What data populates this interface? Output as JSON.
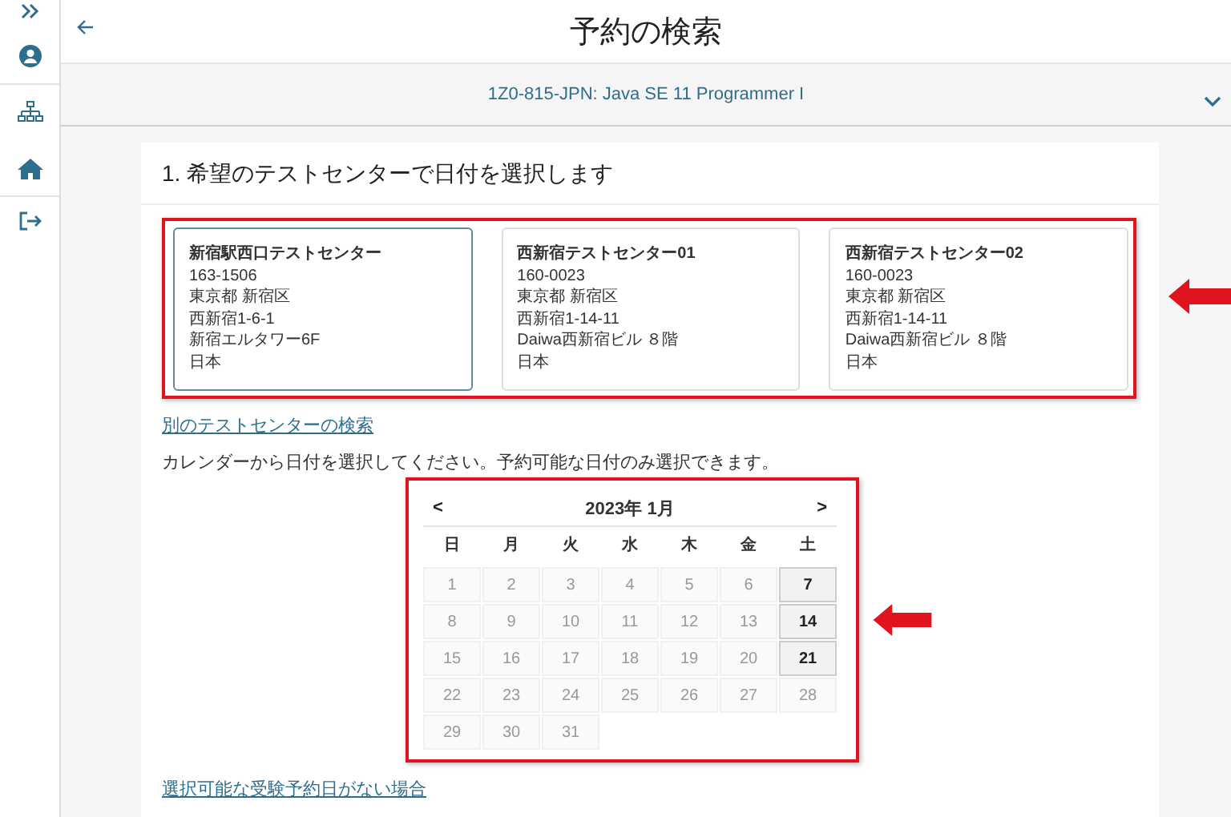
{
  "header": {
    "title": "予約の検索"
  },
  "exam": {
    "label": "1Z0-815-JPN: Java SE 11 Programmer I"
  },
  "step": {
    "heading": "1. 希望のテストセンターで日付を選択します"
  },
  "centers": [
    {
      "name": "新宿駅西口テストセンター",
      "lines": [
        "163-1506",
        "東京都 新宿区",
        "西新宿1-6-1",
        "新宿エルタワー6F",
        "日本"
      ],
      "selected": true
    },
    {
      "name": "西新宿テストセンター01",
      "lines": [
        "160-0023",
        "東京都 新宿区",
        "西新宿1-14-11",
        "Daiwa西新宿ビル ８階",
        "日本"
      ],
      "selected": false
    },
    {
      "name": "西新宿テストセンター02",
      "lines": [
        "160-0023",
        "東京都 新宿区",
        "西新宿1-14-11",
        "Daiwa西新宿ビル ８階",
        "日本"
      ],
      "selected": false
    }
  ],
  "other_center_link": "別のテストセンターの検索",
  "instruction": "カレンダーから日付を選択してください。予約可能な日付のみ選択できます。",
  "calendar": {
    "prev": "<",
    "month": "2023年 1月",
    "next": ">",
    "weekdays": [
      "日",
      "月",
      "火",
      "水",
      "木",
      "金",
      "土"
    ],
    "days": [
      {
        "label": "1",
        "available": false
      },
      {
        "label": "2",
        "available": false
      },
      {
        "label": "3",
        "available": false
      },
      {
        "label": "4",
        "available": false
      },
      {
        "label": "5",
        "available": false
      },
      {
        "label": "6",
        "available": false
      },
      {
        "label": "7",
        "available": true
      },
      {
        "label": "8",
        "available": false
      },
      {
        "label": "9",
        "available": false
      },
      {
        "label": "10",
        "available": false
      },
      {
        "label": "11",
        "available": false
      },
      {
        "label": "12",
        "available": false
      },
      {
        "label": "13",
        "available": false
      },
      {
        "label": "14",
        "available": true
      },
      {
        "label": "15",
        "available": false
      },
      {
        "label": "16",
        "available": false
      },
      {
        "label": "17",
        "available": false
      },
      {
        "label": "18",
        "available": false
      },
      {
        "label": "19",
        "available": false
      },
      {
        "label": "20",
        "available": false
      },
      {
        "label": "21",
        "available": true
      },
      {
        "label": "22",
        "available": false
      },
      {
        "label": "23",
        "available": false
      },
      {
        "label": "24",
        "available": false
      },
      {
        "label": "25",
        "available": false
      },
      {
        "label": "26",
        "available": false
      },
      {
        "label": "27",
        "available": false
      },
      {
        "label": "28",
        "available": false
      },
      {
        "label": "29",
        "available": false
      },
      {
        "label": "30",
        "available": false
      },
      {
        "label": "31",
        "available": false
      }
    ]
  },
  "no_dates_link": "選択可能な受験予約日がない場合"
}
